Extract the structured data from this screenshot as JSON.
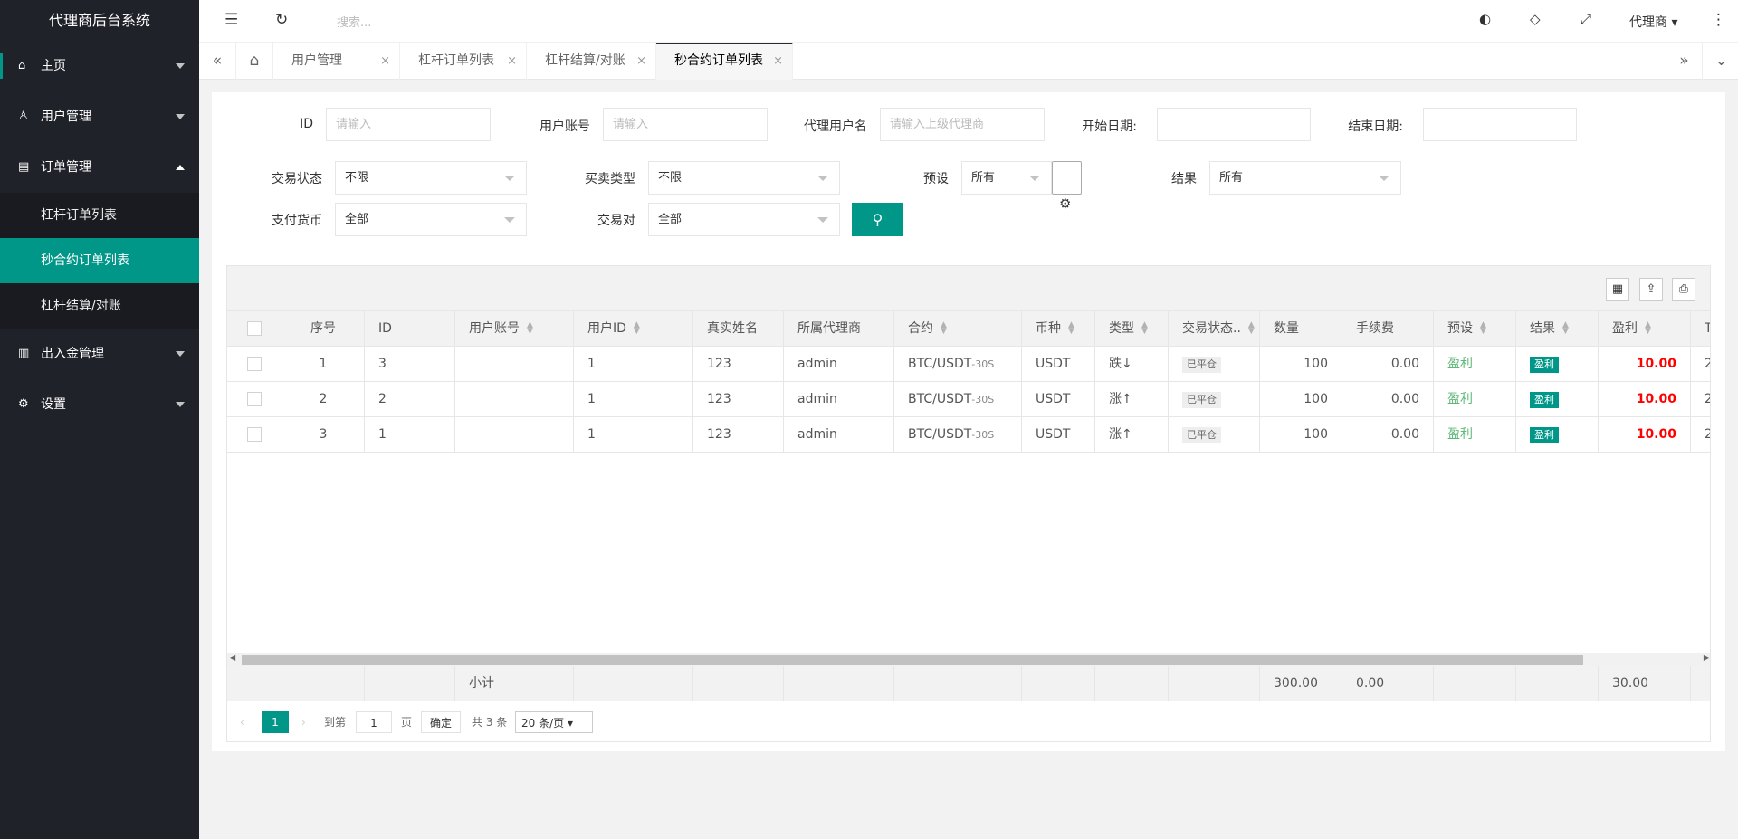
{
  "app": {
    "title": "代理商后台系统"
  },
  "sidebar": {
    "items": [
      {
        "label": "主页",
        "icon": "home-icon"
      },
      {
        "label": "用户管理",
        "icon": "user-icon"
      },
      {
        "label": "订单管理",
        "icon": "order-icon",
        "expanded": true,
        "children": [
          "杠杆订单列表",
          "秒合约订单列表",
          "杠杆结算/对账"
        ],
        "active_child": "秒合约订单列表"
      },
      {
        "label": "出入金管理",
        "icon": "wallet-icon"
      },
      {
        "label": "设置",
        "icon": "gear-icon"
      }
    ]
  },
  "header": {
    "search_placeholder": "搜索...",
    "agent": "代理商"
  },
  "tabs": [
    {
      "label": "用户管理",
      "active": false
    },
    {
      "label": "杠杆订单列表",
      "active": false
    },
    {
      "label": "杠杆结算/对账",
      "active": false
    },
    {
      "label": "秒合约订单列表",
      "active": true
    }
  ],
  "filters": {
    "id": {
      "label": "ID",
      "placeholder": "请输入"
    },
    "account": {
      "label": "用户账号",
      "placeholder": "请输入"
    },
    "agent_user": {
      "label": "代理用户名",
      "placeholder": "请输入上级代理商"
    },
    "start_date": {
      "label": "开始日期:",
      "value": ""
    },
    "end_date": {
      "label": "结束日期:",
      "value": ""
    },
    "trade_status": {
      "label": "交易状态",
      "value": "不限"
    },
    "trade_type": {
      "label": "买卖类型",
      "value": "不限"
    },
    "preset": {
      "label": "预设",
      "value": "所有"
    },
    "result": {
      "label": "结果",
      "value": "所有"
    },
    "currency": {
      "label": "支付货币",
      "value": "全部"
    },
    "pair": {
      "label": "交易对",
      "value": "全部"
    }
  },
  "table": {
    "headers": [
      "序号",
      "ID",
      "用户账号",
      "用户ID",
      "真实姓名",
      "所属代理商",
      "合约",
      "币种",
      "类型",
      "交易状态..",
      "数量",
      "手续费",
      "预设",
      "结果",
      "盈利",
      "T"
    ],
    "rows": [
      {
        "seq": "1",
        "id": "3",
        "account": "",
        "uid": "1",
        "name": "123",
        "agent": "admin",
        "contract": "BTC/USDT",
        "contract_sub": "-30S",
        "coin": "USDT",
        "type": "跌↓",
        "status": "已平仓",
        "qty": "100",
        "fee": "0.00",
        "preset": "盈利",
        "result": "盈利",
        "profit": "10.00",
        "extra": "2"
      },
      {
        "seq": "2",
        "id": "2",
        "account": "",
        "uid": "1",
        "name": "123",
        "agent": "admin",
        "contract": "BTC/USDT",
        "contract_sub": "-30S",
        "coin": "USDT",
        "type": "涨↑",
        "status": "已平仓",
        "qty": "100",
        "fee": "0.00",
        "preset": "盈利",
        "result": "盈利",
        "profit": "10.00",
        "extra": "2"
      },
      {
        "seq": "3",
        "id": "1",
        "account": "",
        "uid": "1",
        "name": "123",
        "agent": "admin",
        "contract": "BTC/USDT",
        "contract_sub": "-30S",
        "coin": "USDT",
        "type": "涨↑",
        "status": "已平仓",
        "qty": "100",
        "fee": "0.00",
        "preset": "盈利",
        "result": "盈利",
        "profit": "10.00",
        "extra": "2"
      }
    ],
    "subtotal": {
      "label": "小计",
      "qty": "300.00",
      "fee": "0.00",
      "profit": "30.00"
    }
  },
  "pager": {
    "current": "1",
    "goto_label": "到第",
    "goto_value": "1",
    "page_unit": "页",
    "confirm": "确定",
    "total": "共 3 条",
    "page_size": "20 条/页"
  },
  "colors": {
    "accent": "#009688",
    "sidebar": "#20222a",
    "profit": "#ff0000"
  }
}
